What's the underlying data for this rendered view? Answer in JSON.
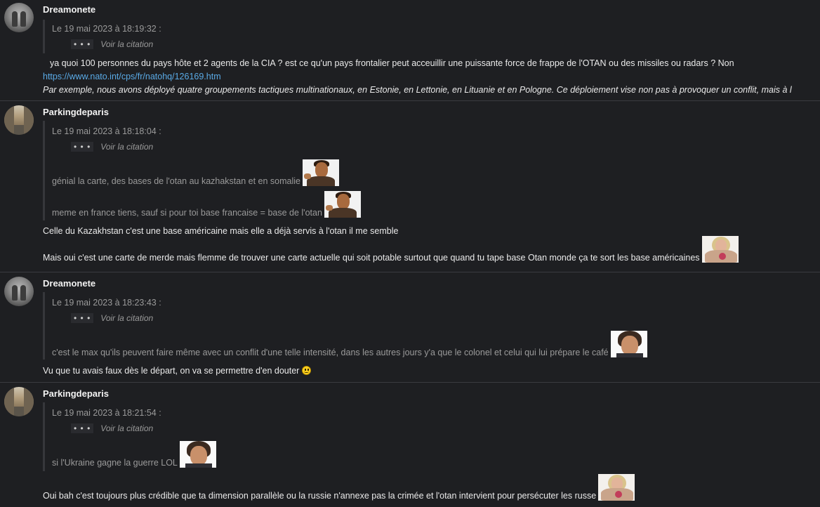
{
  "posts": [
    {
      "username": "Dreamonete",
      "avatar": "dreamonete-avatar",
      "quote": {
        "date": "Le 19 mai 2023 à 18:19:32 :",
        "toggle_dots": "• • •",
        "toggle_label": "Voir la citation",
        "lines": []
      },
      "body": [
        "ya quoi 100 personnes du pays hôte et 2 agents de la CIA ? est ce qu'un pays frontalier peut acceuillir une puissante force de frappe de l'OTAN ou des missiles ou radars ? Non"
      ],
      "link": "https://www.nato.int/cps/fr/natohq/126169.htm",
      "italic": "Par exemple, nous avons déployé quatre groupements tactiques multinationaux, en Estonie, en Lettonie, en Lituanie et en Pologne. Ce déploiement vise non pas à provoquer un conflit, mais à l"
    },
    {
      "username": "Parkingdeparis",
      "avatar": "parkingdeparis-avatar",
      "quote": {
        "date": "Le 19 mai 2023 à 18:18:04 :",
        "toggle_dots": "• • •",
        "toggle_label": "Voir la citation",
        "lines": [
          "génial la carte, des bases de l'otan au kazhakstan et en somalie",
          "meme en france tiens, sauf si pour toi base francaise = base de l'otan"
        ]
      },
      "body": [
        "Celle du Kazakhstan c'est une base américaine mais elle a déjà servis à l'otan il me semble",
        "Mais oui c'est une carte de merde mais flemme de trouver une carte actuelle qui soit potable surtout que quand tu tape base Otan monde ça te sort les base américaines"
      ]
    },
    {
      "username": "Dreamonete",
      "avatar": "dreamonete-avatar",
      "quote": {
        "date": "Le 19 mai 2023 à 18:23:43 :",
        "toggle_dots": "• • •",
        "toggle_label": "Voir la citation",
        "lines": [
          "c'est le max qu'ils peuvent faire même avec un conflit d'une telle intensité, dans les autres jours y'a que le colonel et celui qui lui prépare le café"
        ]
      },
      "body": [
        "Vu que tu avais faux dès le départ, on va se permettre d'en douter"
      ]
    },
    {
      "username": "Parkingdeparis",
      "avatar": "parkingdeparis-avatar",
      "quote": {
        "date": "Le 19 mai 2023 à 18:21:54 :",
        "toggle_dots": "• • •",
        "toggle_label": "Voir la citation",
        "lines": [
          "si l'Ukraine gagne la guerre LOL"
        ]
      },
      "body": [
        "Oui bah c'est toujours plus crédible que ta dimension parallèle ou la russie n'annexe pas la crimée et l'otan intervient pour persécuter les russe"
      ]
    }
  ],
  "colors": {
    "background": "#1e1f22",
    "text": "#eaeaea",
    "quote_text": "#9a9a9a",
    "link": "#5aaae6",
    "separator": "#3a3b40"
  },
  "icons": [
    "smiley-icon",
    "sticker-mustache-man",
    "sticker-dark-hair-man",
    "sticker-blonde-person"
  ]
}
